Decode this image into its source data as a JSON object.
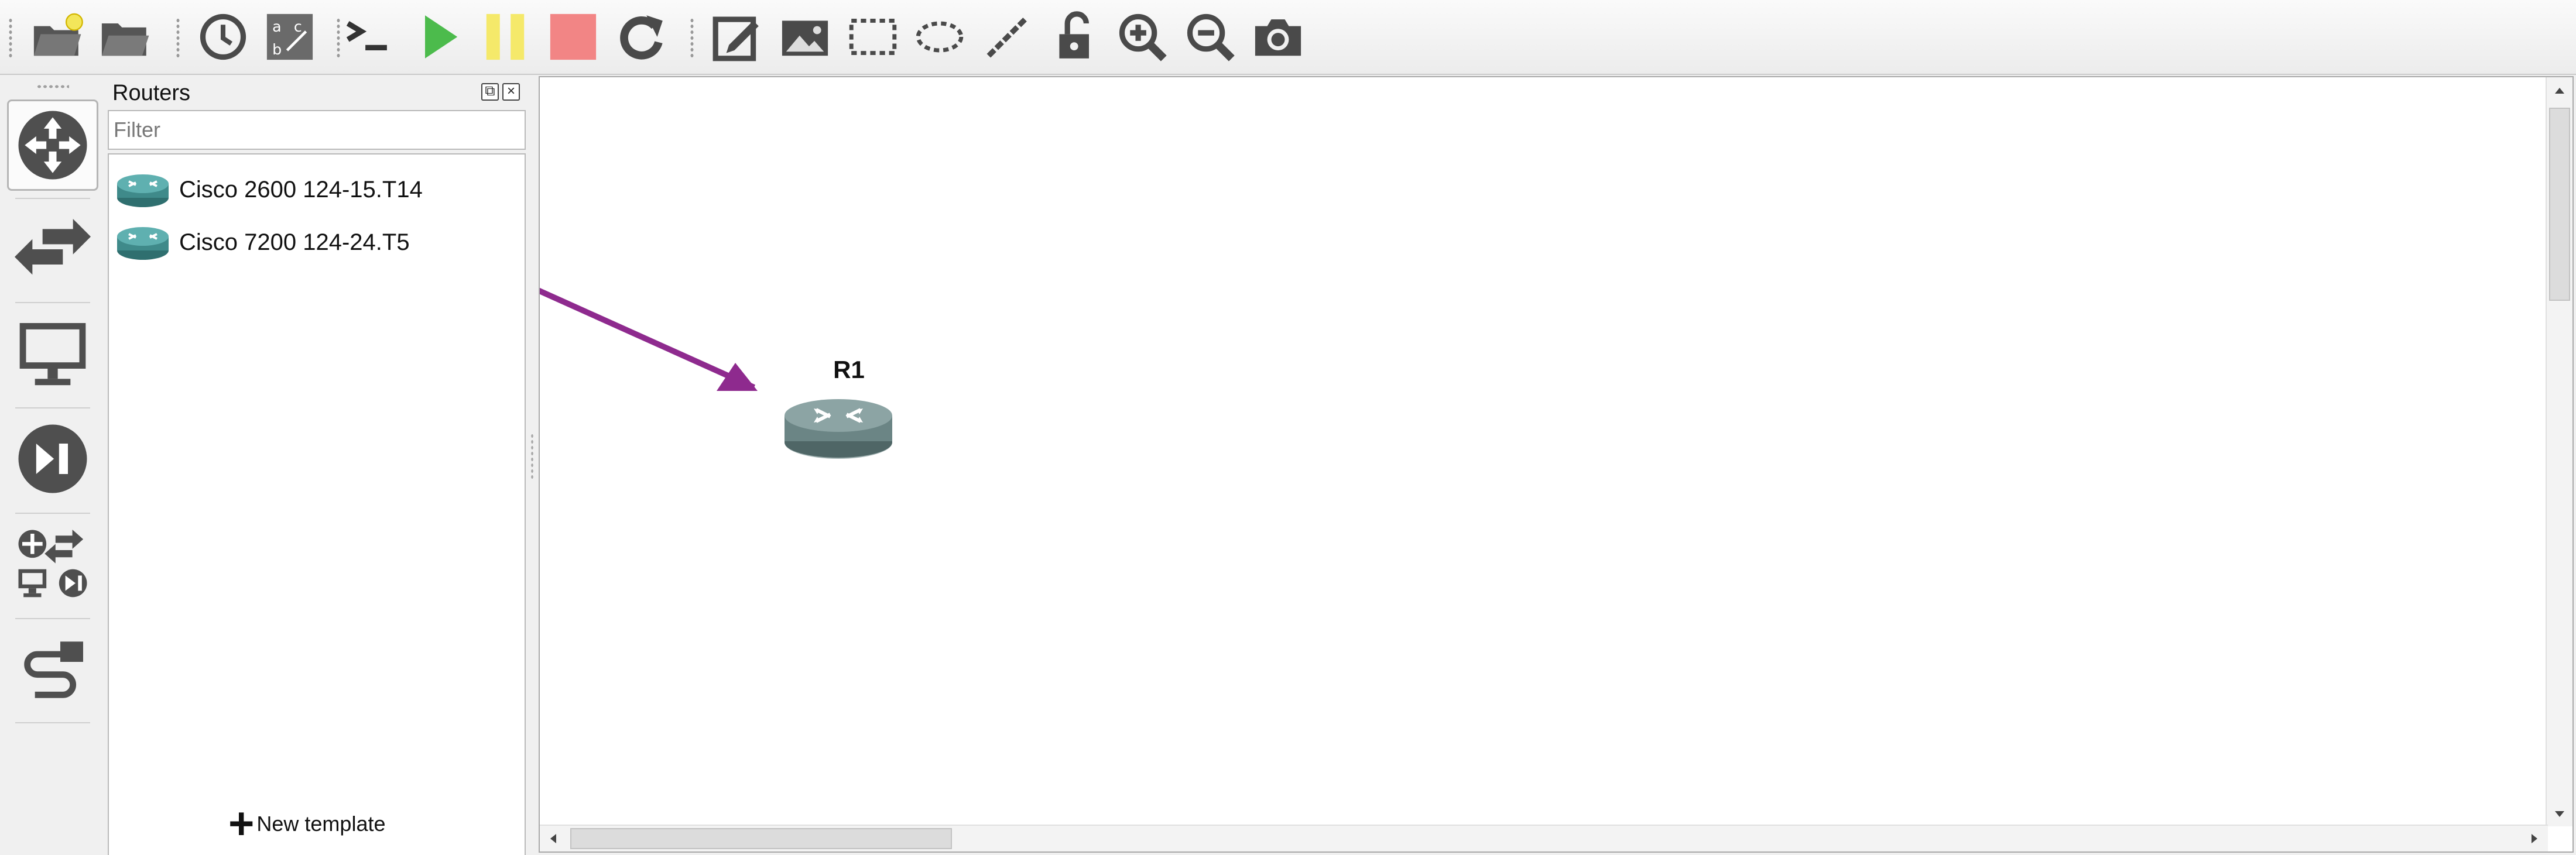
{
  "toolbar": {
    "buttons": [
      {
        "name": "new-project-icon"
      },
      {
        "name": "open-project-icon"
      },
      {
        "name": "snapshot-icon"
      },
      {
        "name": "show-interface-labels-icon"
      },
      {
        "name": "console-icon"
      },
      {
        "name": "start-icon",
        "color": "#4cbb4c"
      },
      {
        "name": "suspend-icon",
        "color": "#f5e96a"
      },
      {
        "name": "stop-icon",
        "color": "#f28585"
      },
      {
        "name": "reload-icon"
      },
      {
        "name": "add-note-icon"
      },
      {
        "name": "insert-picture-icon"
      },
      {
        "name": "draw-rectangle-icon"
      },
      {
        "name": "draw-ellipse-icon"
      },
      {
        "name": "draw-line-icon"
      },
      {
        "name": "lock-icon"
      },
      {
        "name": "zoom-in-icon"
      },
      {
        "name": "zoom-out-icon"
      },
      {
        "name": "screenshot-icon"
      }
    ]
  },
  "device_bar": {
    "items": [
      {
        "name": "browse-routers-icon",
        "active": true
      },
      {
        "name": "browse-switches-icon"
      },
      {
        "name": "browse-end-devices-icon"
      },
      {
        "name": "browse-security-devices-icon"
      },
      {
        "name": "browse-all-devices-icon"
      },
      {
        "name": "add-link-icon"
      }
    ]
  },
  "dock": {
    "title": "Routers",
    "filter_placeholder": "Filter",
    "filter_value": "",
    "items": [
      {
        "label": "Cisco 2600 124-15.T14"
      },
      {
        "label": "Cisco 7200 124-24.T5"
      }
    ],
    "new_template_label": "New template"
  },
  "canvas": {
    "nodes": [
      {
        "label": "R1",
        "type": "router-icon"
      }
    ],
    "annotation_arrow_color": "#8e2a8e"
  },
  "colors": {
    "router_body": "#6b8585",
    "router_list_icon": "#3f8a8a",
    "start": "#4cbb4c",
    "suspend": "#f5e96a",
    "stop": "#f28585"
  }
}
